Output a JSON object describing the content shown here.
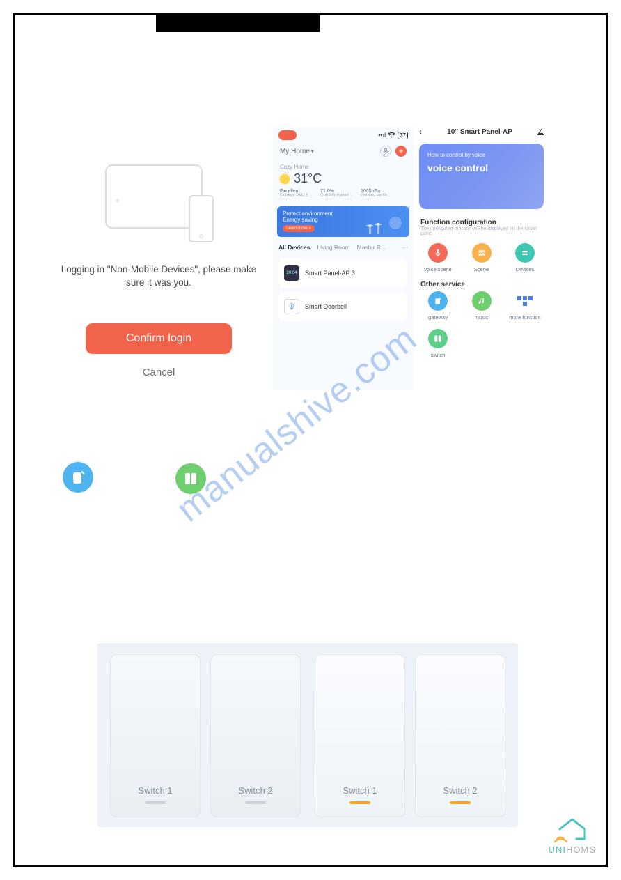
{
  "login": {
    "message": "Logging in \"Non-Mobile Devices\", please make sure it was you.",
    "confirm": "Confirm login",
    "cancel": "Cancel"
  },
  "phone1": {
    "battery": "37",
    "home_label": "My Home",
    "cozy": "Cozy Home",
    "temp": "31°C",
    "stats": [
      {
        "v": "Excellent",
        "l": "Outdoor PM2.5"
      },
      {
        "v": "71.0%",
        "l": "Outdoor Humid..."
      },
      {
        "v": "1005hPa",
        "l": "Outdoor Air Pr..."
      }
    ],
    "banner_line1": "Protect environment",
    "banner_line2": "Energy saving",
    "banner_cta": "Learn more >",
    "tabs": [
      "All Devices",
      "Living Room",
      "Master R..."
    ],
    "devices": [
      {
        "name": "Smart Panel-AP 3"
      },
      {
        "name": "Smart Doorbell"
      }
    ]
  },
  "phone2": {
    "title": "10'' Smart Panel-AP",
    "card_small": "How to control by voice",
    "card_big": "voice control",
    "section1_title": "Function configuration",
    "section1_sub": "The configured function will be displayed on the smart panel",
    "func": [
      {
        "label": "voice scene"
      },
      {
        "label": "Scene"
      },
      {
        "label": "Devices"
      }
    ],
    "section2_title": "Other service",
    "svc": [
      {
        "label": "gateway"
      },
      {
        "label": "music"
      },
      {
        "label": "more function"
      },
      {
        "label": "switch"
      }
    ]
  },
  "switches": {
    "off": [
      "Switch 1",
      "Switch 2"
    ],
    "on": [
      "Switch 1",
      "Switch 2"
    ]
  },
  "watermark": "manualshive.com",
  "logo": {
    "part1": "UNI",
    "part2": "HOMS"
  }
}
